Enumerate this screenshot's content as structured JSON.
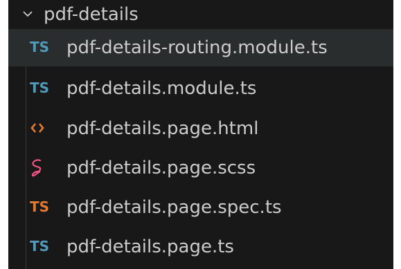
{
  "explorer": {
    "folder": {
      "label": "pdf-details",
      "icon": "chevron-down-icon"
    },
    "files": [
      {
        "label": "pdf-details-routing.module.ts",
        "icon_text": "TS",
        "icon": "typescript-icon",
        "color": "#519aba",
        "selected": true
      },
      {
        "label": "pdf-details.module.ts",
        "icon_text": "TS",
        "icon": "typescript-icon",
        "color": "#519aba",
        "selected": false
      },
      {
        "label": "pdf-details.page.html",
        "icon_text": "<>",
        "icon": "html-icon",
        "color": "#e37933",
        "selected": false
      },
      {
        "label": "pdf-details.page.scss",
        "icon_text": "",
        "icon": "sass-icon",
        "color": "#f55385",
        "selected": false
      },
      {
        "label": "pdf-details.page.spec.ts",
        "icon_text": "TS",
        "icon": "typescript-test-icon",
        "color": "#e37933",
        "selected": false
      },
      {
        "label": "pdf-details.page.ts",
        "icon_text": "TS",
        "icon": "typescript-icon",
        "color": "#519aba",
        "selected": false
      }
    ]
  }
}
